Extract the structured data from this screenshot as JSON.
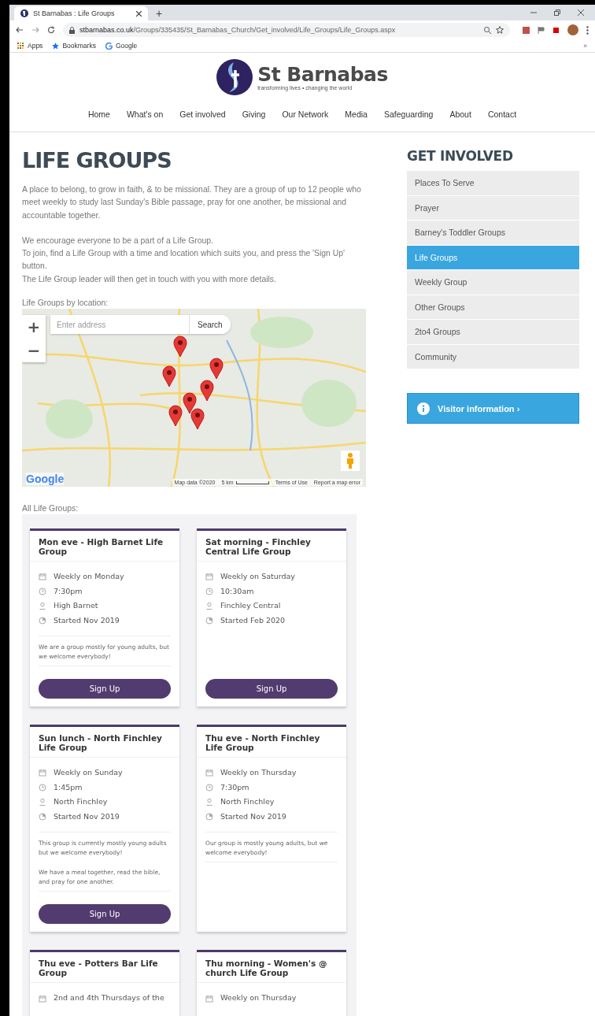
{
  "browser": {
    "tab_title": "St Barnabas : Life Groups",
    "new_tab": "+",
    "url_host": "stbarnabas.co.uk",
    "url_path": "/Groups/335435/St_Barnabas_Church/Get_involved/Life_Groups/Life_Groups.aspx",
    "bookmarks": [
      "Apps",
      "Bookmarks",
      "Google"
    ],
    "overflow": "»"
  },
  "site": {
    "logo_title": "St Barnabas",
    "tagline": "transforming lives • changing the world",
    "nav": [
      "Home",
      "What's on",
      "Get involved",
      "Giving",
      "Our Network",
      "Media",
      "Safeguarding",
      "About",
      "Contact"
    ]
  },
  "page": {
    "title": "LIFE GROUPS",
    "intro": [
      "A place to belong, to grow in faith, & to be missional. They are a group of up to 12 people who meet weekly to study last Sunday's Bible passage, pray for one another, be missional and accountable together.",
      "We encourage everyone to be a part of a Life Group.\nTo join, find a Life Group with a time and location which suits you, and press the 'Sign Up' button.\nThe Life Group leader will then get in touch with you with more details."
    ],
    "map_label": "Life Groups by location:",
    "map": {
      "zoom_in": "+",
      "zoom_out": "−",
      "placeholder": "Enter address",
      "search_button": "Search",
      "logo": "Google",
      "attribution": "Map data ©2020",
      "scale": "5 km",
      "terms": "Terms of Use",
      "report": "Report a map error"
    },
    "groups_label": "All Life Groups:",
    "groups": [
      {
        "title": "Mon eve - High Barnet Life Group",
        "schedule": "Weekly on Monday",
        "time": "7:30pm",
        "location": "High Barnet",
        "started": "Started Nov 2019",
        "notes": [
          "We are a group mostly for young adults, but we welcome everybody!"
        ],
        "button": "Sign Up"
      },
      {
        "title": "Sat morning - Finchley Central Life Group",
        "schedule": "Weekly on Saturday",
        "time": "10:30am",
        "location": "Finchley Central",
        "started": "Started Feb 2020",
        "button": "Sign Up"
      },
      {
        "title": "Sun lunch - North Finchley Life Group",
        "schedule": "Weekly on Sunday",
        "time": "1:45pm",
        "location": "North Finchley",
        "started": "Started Nov 2019",
        "notes": [
          "This group is currently mostly young adults but we welcome everybody!",
          "We have a meal together, read the bible, and pray for one another."
        ],
        "button": "Sign Up"
      },
      {
        "title": "Thu eve - North Finchley Life Group",
        "schedule": "Weekly on Thursday",
        "time": "7:30pm",
        "location": "North Finchley",
        "started": "Started Nov 2019",
        "notes": [
          "Our group is mostly young adults, but we welcome everybody!"
        ]
      },
      {
        "title": "Thu eve - Potters Bar Life Group",
        "schedule": "2nd and 4th Thursdays of the"
      },
      {
        "title": "Thu morning - Women's @ church Life Group",
        "schedule": "Weekly on Thursday"
      }
    ]
  },
  "sidebar": {
    "heading": "GET INVOLVED",
    "items": [
      {
        "label": "Places To Serve",
        "selected": false
      },
      {
        "label": "Prayer",
        "selected": false
      },
      {
        "label": "Barney's Toddler Groups",
        "selected": false
      },
      {
        "label": "Life Groups",
        "selected": true
      },
      {
        "label": "Weekly Group",
        "selected": false
      },
      {
        "label": "Other Groups",
        "selected": false
      },
      {
        "label": "2to4 Groups",
        "selected": false
      },
      {
        "label": "Community",
        "selected": false
      }
    ],
    "visitor_button": "Visitor information ›"
  }
}
